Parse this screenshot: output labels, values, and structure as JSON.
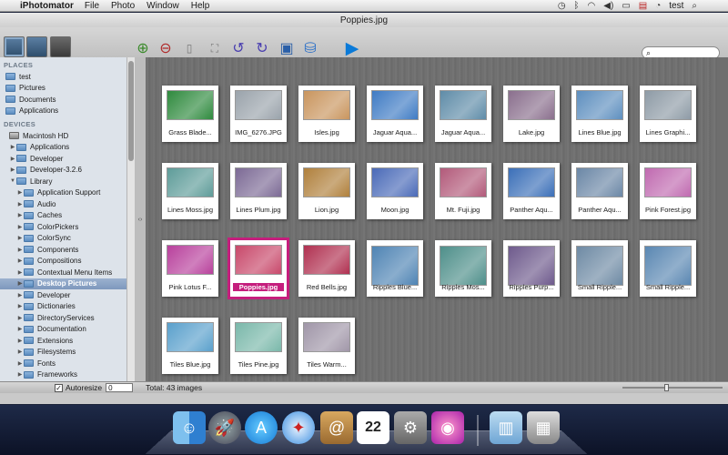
{
  "menubar": {
    "app_name": "iPhotomator",
    "menus": [
      "File",
      "Photo",
      "Window",
      "Help"
    ],
    "user": "test"
  },
  "window": {
    "title": "Poppies.jpg"
  },
  "search": {
    "placeholder": ""
  },
  "sidebar": {
    "places_header": "PLACES",
    "places": [
      "test",
      "Pictures",
      "Documents",
      "Applications"
    ],
    "devices_header": "DEVICES",
    "devices": [
      {
        "label": "Macintosh HD",
        "depth": 0,
        "arrow": "▼"
      },
      {
        "label": "Applications",
        "depth": 1,
        "arrow": "▶"
      },
      {
        "label": "Developer",
        "depth": 1,
        "arrow": "▶"
      },
      {
        "label": "Developer-3.2.6",
        "depth": 1,
        "arrow": "▶"
      },
      {
        "label": "Library",
        "depth": 1,
        "arrow": "▼"
      },
      {
        "label": "Application Support",
        "depth": 2,
        "arrow": "▶"
      },
      {
        "label": "Audio",
        "depth": 2,
        "arrow": "▶"
      },
      {
        "label": "Caches",
        "depth": 2,
        "arrow": "▶"
      },
      {
        "label": "ColorPickers",
        "depth": 2,
        "arrow": "▶"
      },
      {
        "label": "ColorSync",
        "depth": 2,
        "arrow": "▶"
      },
      {
        "label": "Components",
        "depth": 2,
        "arrow": "▶"
      },
      {
        "label": "Compositions",
        "depth": 2,
        "arrow": "▶"
      },
      {
        "label": "Contextual Menu Items",
        "depth": 2,
        "arrow": "▶"
      },
      {
        "label": "Desktop Pictures",
        "depth": 2,
        "arrow": "▶",
        "selected": true
      },
      {
        "label": "Developer",
        "depth": 2,
        "arrow": "▶"
      },
      {
        "label": "Dictionaries",
        "depth": 2,
        "arrow": "▶"
      },
      {
        "label": "DirectoryServices",
        "depth": 2,
        "arrow": "▶"
      },
      {
        "label": "Documentation",
        "depth": 2,
        "arrow": "▶"
      },
      {
        "label": "Extensions",
        "depth": 2,
        "arrow": "▶"
      },
      {
        "label": "Filesystems",
        "depth": 2,
        "arrow": "▶"
      },
      {
        "label": "Fonts",
        "depth": 2,
        "arrow": "▶"
      },
      {
        "label": "Frameworks",
        "depth": 2,
        "arrow": "▶"
      }
    ]
  },
  "thumbnails": [
    {
      "caption": "Grass Blade...",
      "color": "#2f8a3e"
    },
    {
      "caption": "IMG_6276.JPG",
      "color": "#9aa3ab"
    },
    {
      "caption": "Isles.jpg",
      "color": "#c9955e"
    },
    {
      "caption": "Jaguar Aqua...",
      "color": "#3f7bc4"
    },
    {
      "caption": "Jaguar Aqua...",
      "color": "#5f8ca8"
    },
    {
      "caption": "Lake.jpg",
      "color": "#8a6f8d"
    },
    {
      "caption": "Lines Blue.jpg",
      "color": "#5e8fbf"
    },
    {
      "caption": "Lines Graphi...",
      "color": "#8e9ba6"
    },
    {
      "caption": "Lines Moss.jpg",
      "color": "#5e9c99"
    },
    {
      "caption": "Lines Plum.jpg",
      "color": "#7c6a95"
    },
    {
      "caption": "Lion.jpg",
      "color": "#b0803c"
    },
    {
      "caption": "Moon.jpg",
      "color": "#4a6ab8"
    },
    {
      "caption": "Mt. Fuji.jpg",
      "color": "#b25a7a"
    },
    {
      "caption": "Panther Aqu...",
      "color": "#3b6fb8"
    },
    {
      "caption": "Panther Aqu...",
      "color": "#6b87a6"
    },
    {
      "caption": "Pink Forest.jpg",
      "color": "#c06ab0"
    },
    {
      "caption": "Pink Lotus F...",
      "color": "#b8409c"
    },
    {
      "caption": "Poppies.jpg",
      "color": "#c8486a",
      "selected": true
    },
    {
      "caption": "Red Bells.jpg",
      "color": "#b03050"
    },
    {
      "caption": "Ripples Blue...",
      "color": "#4f84b4"
    },
    {
      "caption": "Ripples Mos...",
      "color": "#4e8f8a"
    },
    {
      "caption": "Ripples Purp...",
      "color": "#6e5a8c"
    },
    {
      "caption": "Small Ripple...",
      "color": "#6e8aa4"
    },
    {
      "caption": "Small Ripple...",
      "color": "#5a87b2"
    },
    {
      "caption": "Tiles Blue.jpg",
      "color": "#5aa0cc"
    },
    {
      "caption": "Tiles Pine.jpg",
      "color": "#7ab8aa"
    },
    {
      "caption": "Tiles Warm...",
      "color": "#a096a8"
    }
  ],
  "statusbar": {
    "autoresize_label": "Autoresize",
    "autoresize_value": "0",
    "total_text": "Total: 43 images"
  },
  "colors": {
    "selection": "#c51e7d",
    "sidebar_bg": "#dde3ea"
  },
  "dock": {
    "calendar_day": "22",
    "icons": [
      "finder-icon",
      "rocket-icon",
      "app-store-icon",
      "safari-icon",
      "address-book-icon",
      "calendar-icon",
      "system-preferences-icon",
      "iphotomator-icon",
      "documents-folder-icon",
      "trash-icon"
    ]
  }
}
